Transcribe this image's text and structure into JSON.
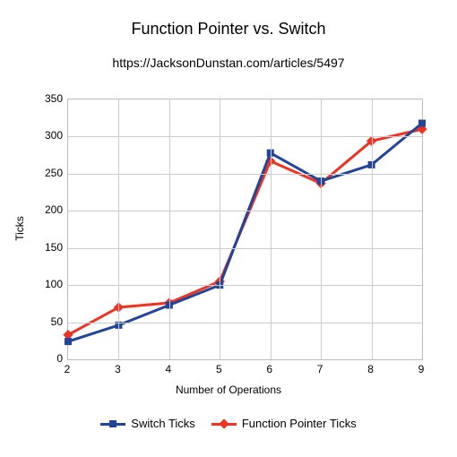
{
  "chart_data": {
    "type": "line",
    "title": "Function Pointer vs. Switch",
    "subtitle": "https://JacksonDunstan.com/articles/5497",
    "xlabel": "Number of Operations",
    "ylabel": "Ticks",
    "xlim": [
      2,
      9
    ],
    "ylim": [
      0,
      350
    ],
    "x": [
      2,
      3,
      4,
      5,
      6,
      7,
      8,
      9
    ],
    "yticks": [
      0,
      50,
      100,
      150,
      200,
      250,
      300,
      350
    ],
    "series": [
      {
        "name": "Switch Ticks",
        "values": [
          24,
          46,
          73,
          100,
          278,
          240,
          262,
          318
        ],
        "color": "#224499",
        "marker": "square"
      },
      {
        "name": "Function Pointer Ticks",
        "values": [
          33,
          70,
          76,
          105,
          267,
          237,
          294,
          310
        ],
        "color": "#ee3322",
        "marker": "diamond"
      }
    ],
    "grid": true,
    "legend_position": "bottom"
  }
}
